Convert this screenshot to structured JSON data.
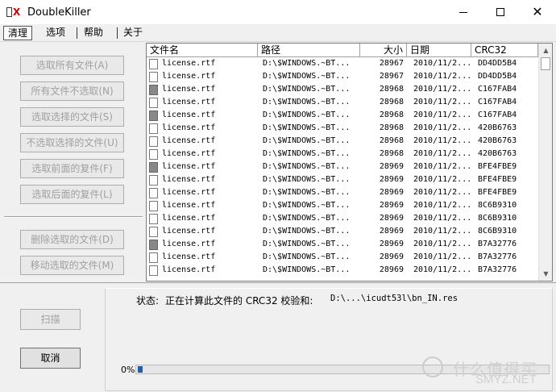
{
  "window": {
    "title": "DoubleKiller",
    "minimize": "—",
    "maximize": "☐",
    "close": "✕"
  },
  "menu": [
    {
      "label": "清理",
      "active": true
    },
    {
      "label": "选项"
    },
    {
      "label": "帮助"
    },
    {
      "label": "关于"
    }
  ],
  "side_buttons": [
    "选取所有文件(A)",
    "所有文件不选取(N)",
    "选取选择的文件(S)",
    "不选取选择的文件(U)",
    "选取前面的复件(F)",
    "选取后面的复件(L)",
    "删除选取的文件(D)",
    "移动选取的文件(M)"
  ],
  "columns": [
    "文件名",
    "路径",
    "大小",
    "日期",
    "CRC32"
  ],
  "rows": [
    {
      "name": "license.rtf",
      "path": "D:\\$WINDOWS.~BT...",
      "size": "28967",
      "date": "2010/11/2...",
      "crc": "DD4DD5B4",
      "dark": false
    },
    {
      "name": "license.rtf",
      "path": "D:\\$WINDOWS.~BT...",
      "size": "28967",
      "date": "2010/11/2...",
      "crc": "DD4DD5B4",
      "dark": false
    },
    {
      "name": "license.rtf",
      "path": "D:\\$WINDOWS.~BT...",
      "size": "28968",
      "date": "2010/11/2...",
      "crc": "C167FAB4",
      "dark": true
    },
    {
      "name": "license.rtf",
      "path": "D:\\$WINDOWS.~BT...",
      "size": "28968",
      "date": "2010/11/2...",
      "crc": "C167FAB4",
      "dark": false
    },
    {
      "name": "license.rtf",
      "path": "D:\\$WINDOWS.~BT...",
      "size": "28968",
      "date": "2010/11/2...",
      "crc": "C167FAB4",
      "dark": true
    },
    {
      "name": "license.rtf",
      "path": "D:\\$WINDOWS.~BT...",
      "size": "28968",
      "date": "2010/11/2...",
      "crc": "420B6763",
      "dark": false
    },
    {
      "name": "license.rtf",
      "path": "D:\\$WINDOWS.~BT...",
      "size": "28968",
      "date": "2010/11/2...",
      "crc": "420B6763",
      "dark": false
    },
    {
      "name": "license.rtf",
      "path": "D:\\$WINDOWS.~BT...",
      "size": "28968",
      "date": "2010/11/2...",
      "crc": "420B6763",
      "dark": false
    },
    {
      "name": "license.rtf",
      "path": "D:\\$WINDOWS.~BT...",
      "size": "28969",
      "date": "2010/11/2...",
      "crc": "BFE4FBE9",
      "dark": true
    },
    {
      "name": "license.rtf",
      "path": "D:\\$WINDOWS.~BT...",
      "size": "28969",
      "date": "2010/11/2...",
      "crc": "BFE4FBE9",
      "dark": false
    },
    {
      "name": "license.rtf",
      "path": "D:\\$WINDOWS.~BT...",
      "size": "28969",
      "date": "2010/11/2...",
      "crc": "BFE4FBE9",
      "dark": false
    },
    {
      "name": "license.rtf",
      "path": "D:\\$WINDOWS.~BT...",
      "size": "28969",
      "date": "2010/11/2...",
      "crc": "8C6B9310",
      "dark": false
    },
    {
      "name": "license.rtf",
      "path": "D:\\$WINDOWS.~BT...",
      "size": "28969",
      "date": "2010/11/2...",
      "crc": "8C6B9310",
      "dark": false
    },
    {
      "name": "license.rtf",
      "path": "D:\\$WINDOWS.~BT...",
      "size": "28969",
      "date": "2010/11/2...",
      "crc": "8C6B9310",
      "dark": false
    },
    {
      "name": "license.rtf",
      "path": "D:\\$WINDOWS.~BT...",
      "size": "28969",
      "date": "2010/11/2...",
      "crc": "B7A32776",
      "dark": true
    },
    {
      "name": "license.rtf",
      "path": "D:\\$WINDOWS.~BT...",
      "size": "28969",
      "date": "2010/11/2...",
      "crc": "B7A32776",
      "dark": false
    },
    {
      "name": "license.rtf",
      "path": "D:\\$WINDOWS.~BT...",
      "size": "28969",
      "date": "2010/11/2...",
      "crc": "B7A32776",
      "dark": false
    }
  ],
  "scan_button": "扫描",
  "cancel_button": "取消",
  "status": {
    "label": "状态:",
    "text": "正在计算此文件的 CRC32 校验和:",
    "path": "D:\\...\\icudt53l\\bn_IN.res"
  },
  "progress": {
    "label": "0%",
    "value": 0.01
  },
  "watermark": {
    "text": "什么值得买",
    "sub": "SMYZ.NET"
  },
  "colors": {
    "progress_fill": "#06b025",
    "disabled_text": "#a0a0a0"
  }
}
